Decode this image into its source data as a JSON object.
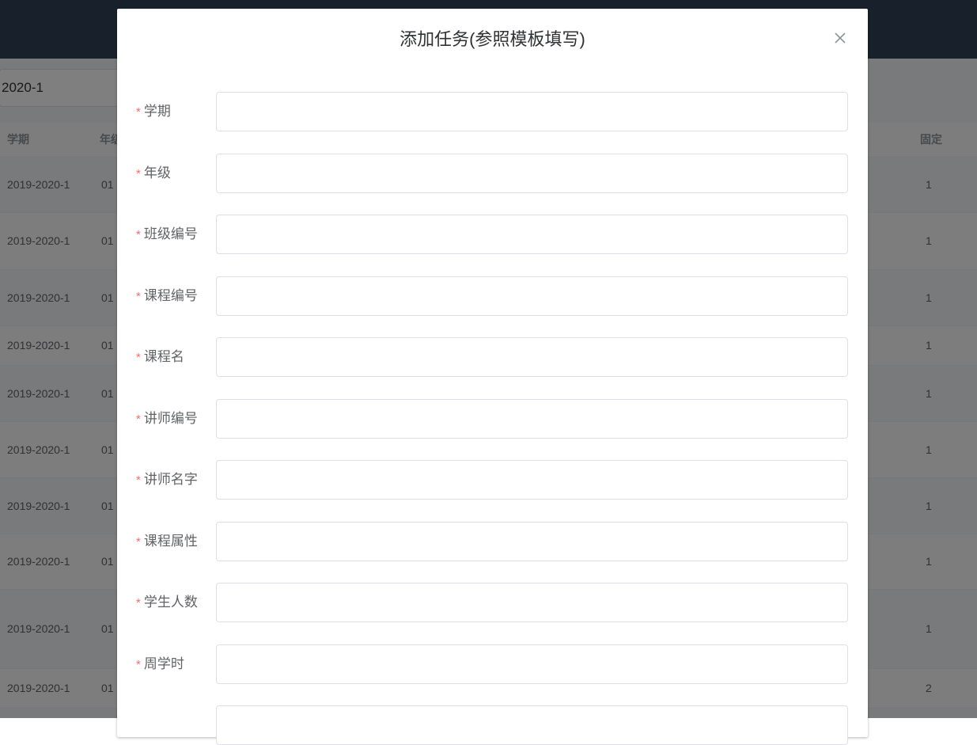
{
  "background": {
    "filter": {
      "semester_value": "2020-1"
    },
    "table": {
      "headers": {
        "semester": "学期",
        "grade": "年级",
        "fixed": "固定"
      },
      "rows": [
        {
          "semester": "2019-2020-1",
          "grade": "01",
          "fixed": "1"
        },
        {
          "semester": "2019-2020-1",
          "grade": "01",
          "fixed": "1"
        },
        {
          "semester": "2019-2020-1",
          "grade": "01",
          "fixed": "1"
        },
        {
          "semester": "2019-2020-1",
          "grade": "01",
          "fixed": "1"
        },
        {
          "semester": "2019-2020-1",
          "grade": "01",
          "fixed": "1"
        },
        {
          "semester": "2019-2020-1",
          "grade": "01",
          "fixed": "1"
        },
        {
          "semester": "2019-2020-1",
          "grade": "01",
          "fixed": "1"
        },
        {
          "semester": "2019-2020-1",
          "grade": "01",
          "fixed": "1"
        },
        {
          "semester": "2019-2020-1",
          "grade": "01",
          "fixed": "1"
        },
        {
          "semester": "2019-2020-1",
          "grade": "01",
          "fixed": "2"
        }
      ]
    }
  },
  "dialog": {
    "title": "添加任务(参照模板填写)",
    "close_icon": "close-icon",
    "required_mark": "*",
    "fields": [
      {
        "label": "学期",
        "value": "",
        "placeholder": ""
      },
      {
        "label": "年级",
        "value": "",
        "placeholder": ""
      },
      {
        "label": "班级编号",
        "value": "",
        "placeholder": ""
      },
      {
        "label": "课程编号",
        "value": "",
        "placeholder": ""
      },
      {
        "label": "课程名",
        "value": "",
        "placeholder": ""
      },
      {
        "label": "讲师编号",
        "value": "",
        "placeholder": ""
      },
      {
        "label": "讲师名字",
        "value": "",
        "placeholder": ""
      },
      {
        "label": "课程属性",
        "value": "",
        "placeholder": ""
      },
      {
        "label": "学生人数",
        "value": "",
        "placeholder": ""
      },
      {
        "label": "周学时",
        "value": "",
        "placeholder": ""
      }
    ]
  },
  "colors": {
    "required": "#f56c6c",
    "mask": "rgba(0,0,0,0.5)",
    "topbar": "#304156"
  }
}
